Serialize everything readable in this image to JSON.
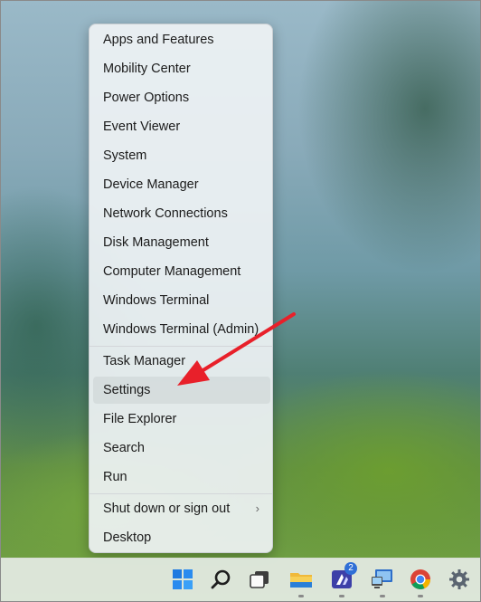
{
  "context_menu": {
    "group1": [
      {
        "label": "Apps and Features"
      },
      {
        "label": "Mobility Center"
      },
      {
        "label": "Power Options"
      },
      {
        "label": "Event Viewer"
      },
      {
        "label": "System"
      },
      {
        "label": "Device Manager"
      },
      {
        "label": "Network Connections"
      },
      {
        "label": "Disk Management"
      },
      {
        "label": "Computer Management"
      },
      {
        "label": "Windows Terminal"
      },
      {
        "label": "Windows Terminal (Admin)"
      }
    ],
    "group2": [
      {
        "label": "Task Manager"
      },
      {
        "label": "Settings",
        "hovered": true
      },
      {
        "label": "File Explorer"
      },
      {
        "label": "Search"
      },
      {
        "label": "Run"
      }
    ],
    "group3": [
      {
        "label": "Shut down or sign out",
        "has_submenu": true
      },
      {
        "label": "Desktop"
      }
    ]
  },
  "taskbar": {
    "icons": [
      "start-icon",
      "search-icon",
      "task-view-icon",
      "file-explorer-icon",
      "notes-app-icon",
      "remote-desktop-icon",
      "chrome-icon",
      "settings-icon"
    ],
    "notes_badge": "2"
  },
  "annotation": {
    "type": "red-arrow",
    "points_to": "Settings",
    "color": "#e8202a"
  }
}
